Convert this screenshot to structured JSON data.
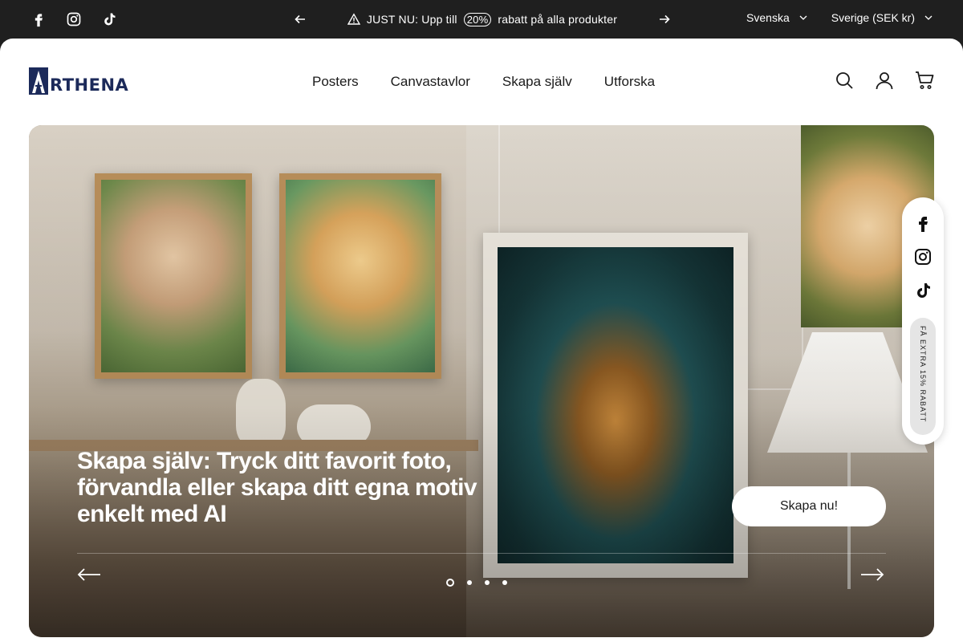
{
  "announcement": {
    "text_before": "JUST NU: Upp till",
    "percent": "20%",
    "text_after": "rabatt på alla produkter"
  },
  "selectors": {
    "language": "Svenska",
    "country": "Sverige (SEK kr)"
  },
  "brand": {
    "name": "RTHENA",
    "color": "#1c2a5a"
  },
  "nav": {
    "items": [
      "Posters",
      "Canvastavlor",
      "Skapa själv",
      "Utforska"
    ]
  },
  "hero": {
    "title": "Skapa själv: Tryck ditt favorit foto, förvandla eller skapa ditt egna motiv enkelt med AI",
    "cta_label": "Skapa nu!",
    "slide_count": 4,
    "active_slide": 1
  },
  "floating": {
    "promo": "FÅ EXTRA 15% RABATT"
  },
  "icons": {
    "top_social": [
      "facebook-icon",
      "instagram-icon",
      "tiktok-icon"
    ],
    "header": [
      "search-icon",
      "account-icon",
      "cart-icon"
    ]
  },
  "colors": {
    "topbar_bg": "#1f1f1f",
    "accent": "#1c2a5a"
  }
}
